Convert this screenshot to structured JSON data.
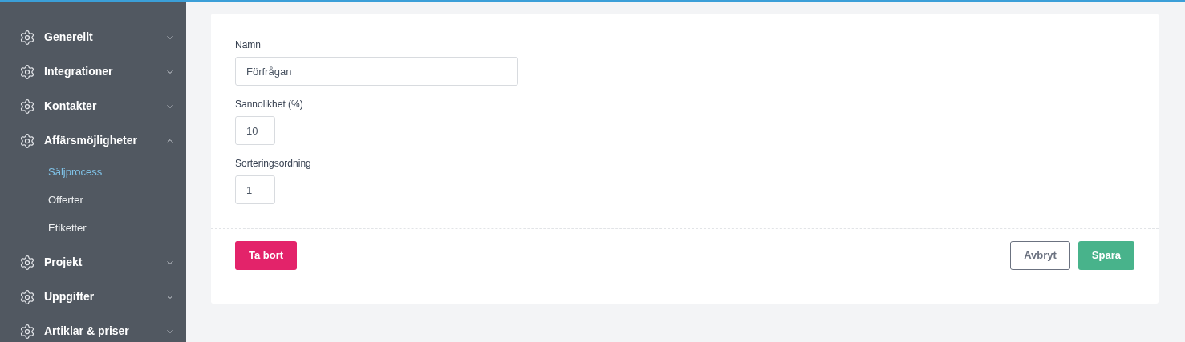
{
  "sidebar": {
    "items": [
      {
        "label": "Generellt",
        "expanded": false
      },
      {
        "label": "Integrationer",
        "expanded": false
      },
      {
        "label": "Kontakter",
        "expanded": false
      },
      {
        "label": "Affärsmöjligheter",
        "expanded": true,
        "children": [
          {
            "label": "Säljprocess",
            "selected": true
          },
          {
            "label": "Offerter",
            "selected": false
          },
          {
            "label": "Etiketter",
            "selected": false
          }
        ]
      },
      {
        "label": "Projekt",
        "expanded": false
      },
      {
        "label": "Uppgifter",
        "expanded": false
      },
      {
        "label": "Artiklar & priser",
        "expanded": false
      }
    ]
  },
  "form": {
    "fields": [
      {
        "label": "Namn",
        "value": "Förfrågan",
        "kind": "wide"
      },
      {
        "label": "Sannolikhet (%)",
        "value": "10",
        "kind": "narrow"
      },
      {
        "label": "Sorteringsordning",
        "value": "1",
        "kind": "narrow"
      }
    ],
    "delete_button": "Ta bort",
    "cancel_button": "Avbryt",
    "save_button": "Spara"
  }
}
